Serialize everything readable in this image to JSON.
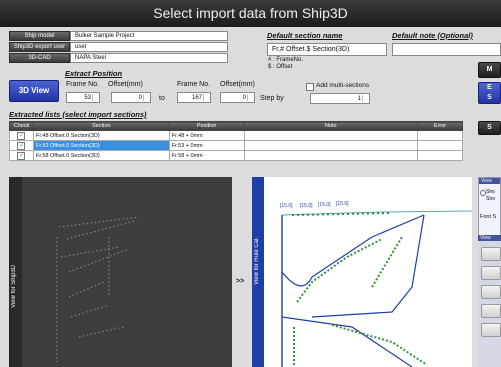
{
  "window": {
    "title": "Select import data from Ship3D"
  },
  "info": {
    "ship_model_label": "Ship model",
    "ship_model_value": "Bulker Sample Project",
    "export_user_label": "Ship3D export user",
    "export_user_value": "user",
    "cad_label": "3D-CAD",
    "cad_value": "NAPA Steel"
  },
  "default_section": {
    "header": "Default section name",
    "value": "Fr.# Offset.$ Section(3D)",
    "legend_frame": "# : FrameNo.",
    "legend_offset": "$ : Offset"
  },
  "default_note": {
    "header": "Default note (Optional)",
    "value": ""
  },
  "extract": {
    "header": "Extract Position",
    "view_button": "3D View",
    "frame_no_label": "Frame No.",
    "offset_label": "Offset(mm)",
    "frame_from": "53",
    "offset_from": "0",
    "to_label": "to",
    "frame_to_label": "Frame No.",
    "offset_to_label": "Offset(mm)",
    "frame_to": "167",
    "offset_to": "0",
    "multi_label": "Add multi-sections",
    "step_label": "Step by",
    "step_value": "1"
  },
  "list": {
    "header": "Extracted lists (select import sections)",
    "columns": [
      "Check",
      "Section",
      "Position",
      "Note",
      "Error"
    ],
    "rows": [
      {
        "section": "Fr.48 Offset.0 Section(3D)",
        "position": "Fr.48 + 0mm",
        "note": "",
        "error": ""
      },
      {
        "section": "Fr.53 Offset.0 Section(3D)",
        "position": "Fr.53 + 0mm",
        "note": "",
        "error": ""
      },
      {
        "section": "Fr.58 Offset.0 Section(3D)",
        "position": "Fr.58 + 0mm",
        "note": "",
        "error": ""
      }
    ]
  },
  "views": {
    "ship3d_label": "View for Ship3D",
    "rulecal_label": "View for Rule Cal.",
    "transfer_arrow": ">>",
    "dim_labels": [
      "[15.0]",
      "[15.0]",
      "[15.0]",
      "[15.0]"
    ]
  },
  "side": {
    "btn_top_fragment": "M",
    "btn_blue_fragment_1": "E",
    "btn_blue_fragment_2": "S",
    "btn_s_fragment": "S",
    "view_fragment_1": "View",
    "show_fragment": "Sho",
    "stro_fragment": "Stro",
    "font_fragment": "Font S",
    "view_fragment_2": "View"
  },
  "colors": {
    "select_blue": "#3b8fe0",
    "accent_blue": "#2133a4",
    "struct_green": "#2f8f3a",
    "struct_blue": "#1f3fa8"
  }
}
